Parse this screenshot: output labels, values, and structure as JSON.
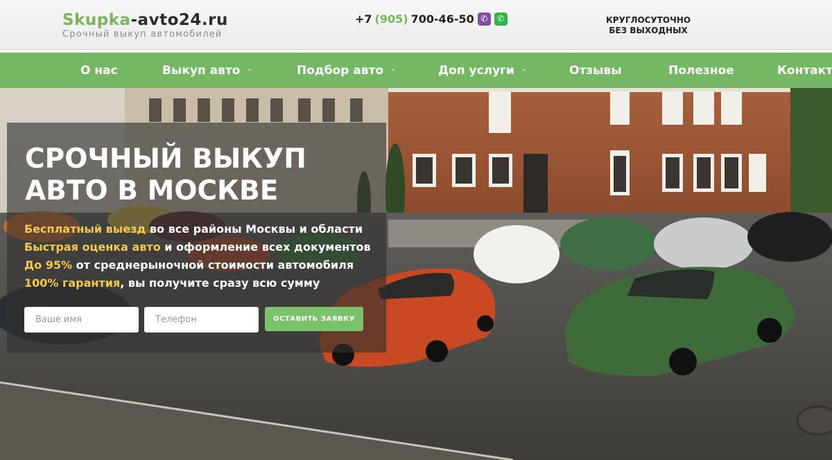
{
  "header": {
    "logo_part1": "Skupka",
    "logo_part2": "-avto24.ru",
    "tagline": "Срочный выкуп автомобилей",
    "phone_prefix": "+7",
    "phone_code": "(905)",
    "phone_number": "700-46-50",
    "hours_line1": "КРУГЛОСУТОЧНО",
    "hours_line2": "БЕЗ ВЫХОДНЫХ",
    "icons": [
      "viber-icon",
      "whatsapp-icon"
    ]
  },
  "nav": {
    "items": [
      {
        "label": "О нас",
        "dropdown": false
      },
      {
        "label": "Выкуп авто",
        "dropdown": true
      },
      {
        "label": "Подбор авто",
        "dropdown": true
      },
      {
        "label": "Доп услуги",
        "dropdown": true
      },
      {
        "label": "Отзывы",
        "dropdown": false
      },
      {
        "label": "Полезное",
        "dropdown": false
      },
      {
        "label": "Контакты",
        "dropdown": false
      }
    ]
  },
  "hero": {
    "title_line1": "СРОЧНЫЙ ВЫКУП",
    "title_line2": "АВТО В МОСКВЕ",
    "bullets": [
      {
        "highlight": "Бесплатный выезд",
        "rest": " во все районы Москвы и области"
      },
      {
        "highlight": "Быстрая оценка авто",
        "rest": " и оформление всех документов"
      },
      {
        "highlight": "До 95%",
        "rest": " от среднерыночной стоимости автомобиля"
      },
      {
        "highlight": "100% гарантия",
        "rest": ", вы получите сразу всю сумму"
      }
    ],
    "form": {
      "name_placeholder": "Ваше имя",
      "phone_placeholder": "Телефон",
      "submit_label": "ОСТАВИТЬ ЗАЯВКУ"
    }
  },
  "colors": {
    "brand_green": "#74b863",
    "highlight_yellow": "#f2c94c",
    "button_green": "#7cc26c"
  }
}
